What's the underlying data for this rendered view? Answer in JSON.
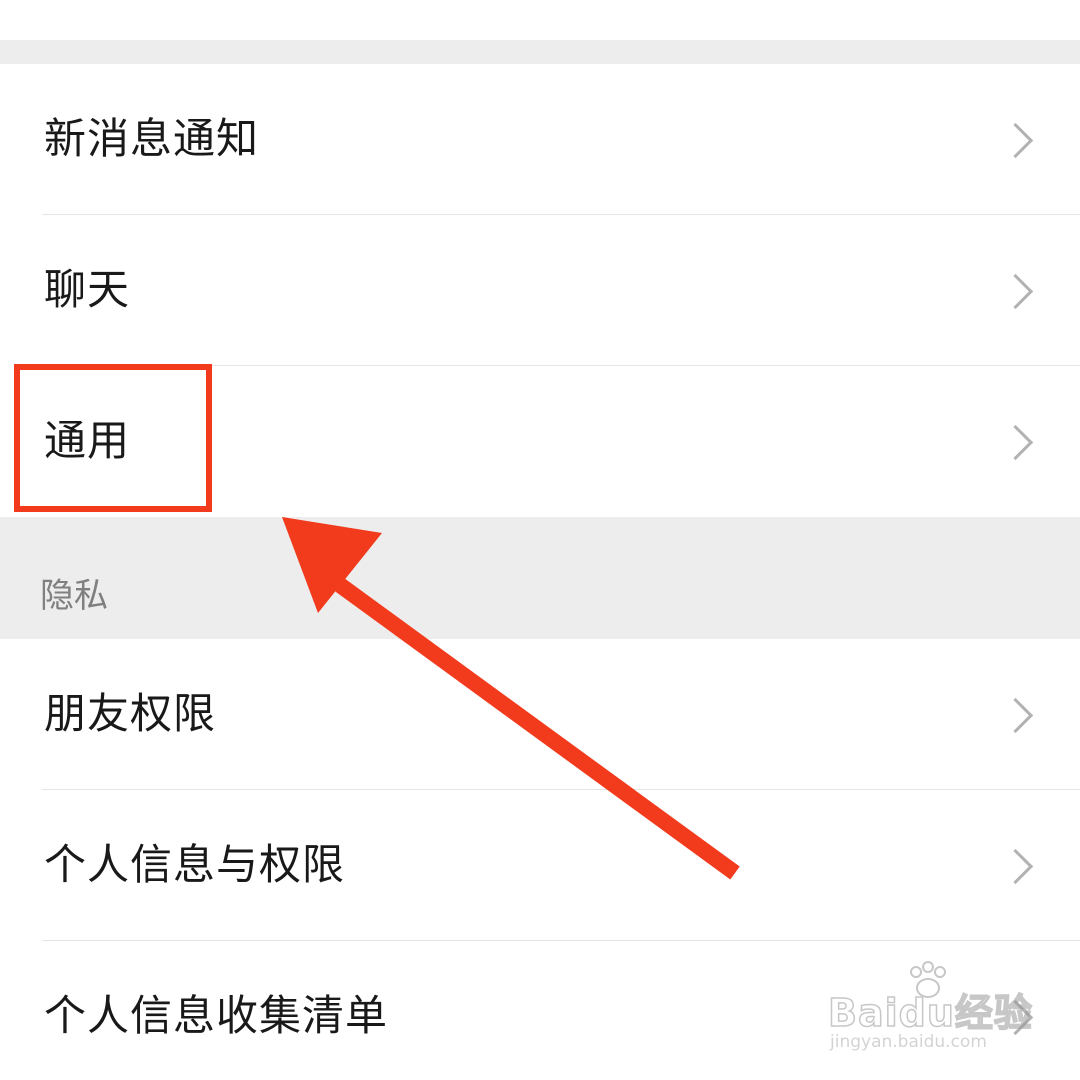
{
  "settings": {
    "group1": [
      {
        "label": "新消息通知"
      },
      {
        "label": "聊天"
      },
      {
        "label": "通用"
      }
    ],
    "privacy_section": {
      "title": "隐私",
      "items": [
        {
          "label": "朋友权限"
        },
        {
          "label": "个人信息与权限"
        },
        {
          "label": "个人信息收集清单"
        }
      ]
    }
  },
  "annotation": {
    "highlight_target": "通用",
    "highlight_color": "#f23a1c",
    "arrow_color": "#f23a1c"
  },
  "watermark": {
    "logo_text": "Baidu经验",
    "url": "jingyan.baidu.com"
  },
  "colors": {
    "background": "#ffffff",
    "group_gap": "#ededed",
    "text_primary": "#191919",
    "text_section": "#808080",
    "chevron": "#b2b2b2",
    "divider": "#e5e5e5"
  }
}
